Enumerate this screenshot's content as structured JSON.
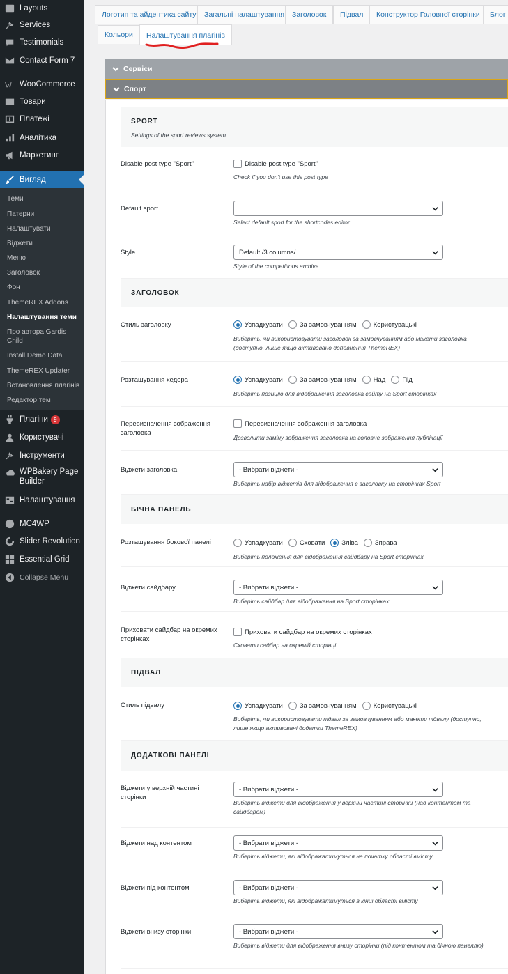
{
  "sidebar": {
    "menu": [
      {
        "label": "Layouts",
        "icon": "layouts-icon"
      },
      {
        "label": "Services",
        "icon": "wrench-icon"
      },
      {
        "label": "Testimonials",
        "icon": "comment-icon"
      },
      {
        "label": "Contact Form 7",
        "icon": "mail-icon"
      },
      {
        "label": "WooCommerce",
        "icon": "woocommerce-icon"
      },
      {
        "label": "Товари",
        "icon": "archive-icon"
      },
      {
        "label": "Платежі",
        "icon": "dollar-icon"
      },
      {
        "label": "Аналітика",
        "icon": "chart-bar-icon"
      },
      {
        "label": "Маркетинг",
        "icon": "megaphone-icon"
      },
      {
        "label": "Вигляд",
        "icon": "paintbrush-icon"
      }
    ],
    "submenu": [
      "Теми",
      "Патерни",
      "Налаштувати",
      "Віджети",
      "Меню",
      "Заголовок",
      "Фон",
      "ThemeREX Addons",
      "Налаштування теми",
      "Про автора Gardis Child",
      "Install Demo Data",
      "ThemeREX Updater",
      "Встановлення плагінів",
      "Редактор тем"
    ],
    "menu2": [
      {
        "label": "Плагіни",
        "icon": "plugins-icon",
        "badge": "9"
      },
      {
        "label": "Користувачі",
        "icon": "users-icon"
      },
      {
        "label": "Інструменти",
        "icon": "tools-icon"
      },
      {
        "label": "WPBakery Page Builder",
        "icon": "wpbakery-icon"
      },
      {
        "label": "Налаштування",
        "icon": "settings-icon"
      },
      {
        "label": "MC4WP",
        "icon": "mc4wp-icon"
      },
      {
        "label": "Slider Revolution",
        "icon": "slider-revolution-icon"
      },
      {
        "label": "Essential Grid",
        "icon": "grid-icon"
      },
      {
        "label": "Collapse Menu",
        "icon": "collapse-icon"
      }
    ]
  },
  "tabs": {
    "row1": [
      "Логотип та айдентика сайту",
      "Загальні налаштування",
      "Заголовок",
      "Підвал",
      "Конструктор Головної сторінки",
      "Блог"
    ],
    "row2": [
      "Кольори",
      "Налаштування плагінів"
    ]
  },
  "panels": {
    "services": "Сервіси",
    "sport": "Спорт"
  },
  "sections": {
    "sport": {
      "title": "SPORT",
      "subtitle": "Settings of the sport reviews system"
    },
    "header": {
      "title": "ЗАГОЛОВОК"
    },
    "sidebar": {
      "title": "БІЧНА ПАНЕЛЬ"
    },
    "footer": {
      "title": "ПІДВАЛ"
    },
    "extra": {
      "title": "ДОДАТКОВІ ПАНЕЛІ"
    }
  },
  "rows": {
    "disable_post": {
      "label": "Disable post type \"Sport\"",
      "checkbox": "Disable post type \"Sport\"",
      "desc": "Check if you don't use this post type"
    },
    "default_sport": {
      "label": "Default sport",
      "value": "",
      "desc": "Select default sport for the shortcodes editor"
    },
    "style": {
      "label": "Style",
      "value": "Default /3 columns/",
      "desc": "Style of the competitions archive"
    },
    "header_style": {
      "label": "Стиль заголовку",
      "options": [
        "Успадкувати",
        "За замовчуванням",
        "Користувацькі"
      ],
      "selected": "Успадкувати",
      "desc": "Виберіть, чи використовувати заголовок за замовчуванням або макети заголовка (доступно, лише якщо активовано доповнення ThemeREX)"
    },
    "header_pos": {
      "label": "Розташування хедера",
      "options": [
        "Успадкувати",
        "За замовчуванням",
        "Над",
        "Під"
      ],
      "selected": "Успадкувати",
      "desc": "Виберіть позицію для відображення заголовка сайту на Sport сторінках"
    },
    "header_image": {
      "label": "Перевизначення зображення заголовка",
      "checkbox": "Перевизначення зображення заголовка",
      "desc": "Дозволити заміну зображення заголовка на головне зображення публікації"
    },
    "header_widgets": {
      "label": "Віджети заголовка",
      "value": "- Вибрати віджети -",
      "desc": "Виберіть набір віджетів для відображення в заголовку на сторінках Sport"
    },
    "sidebar_pos": {
      "label": "Розташування бокової панелі",
      "options": [
        "Успадкувати",
        "Сховати",
        "Зліва",
        "Зправа"
      ],
      "selected": "Зліва",
      "desc": "Виберіть положення для відображення сайдбару на Sport сторінках"
    },
    "sidebar_widgets": {
      "label": "Віджети сайдбару",
      "value": "- Вибрати віджети -",
      "desc": "Виберіть сайдбар для відображення на Sport сторінках"
    },
    "hide_sidebar": {
      "label": "Приховати сайдбар на окремих сторінках",
      "checkbox": "Приховати сайдбар на окремих сторінках",
      "desc": "Сховати садбар на окремій сторінці"
    },
    "footer_style": {
      "label": "Стиль підвалу",
      "options": [
        "Успадкувати",
        "За замовчуванням",
        "Користувацькі"
      ],
      "selected": "Успадкувати",
      "desc": "Виберіть, чи використовувати підвал за замовчуванням або макети підвалу (доступно, лише якщо активовані додатки ThemeREX)"
    },
    "top_widgets": {
      "label": "Віджети у верхній частині сторінки",
      "value": "- Вибрати віджети -",
      "desc": "Виберіть віджети для відображення у верхній частині сторінки (над контентом та сайдбаром)"
    },
    "above_widgets": {
      "label": "Віджети над контентом",
      "value": "- Вибрати віджети -",
      "desc": "Виберіть віджети, які відображатимуться на початку області вмісту"
    },
    "below_widgets": {
      "label": "Віджети під контентом",
      "value": "- Вибрати віджети -",
      "desc": "Виберіть віджети, які відображатимуться в кінці області вмісту"
    },
    "bottom_widgets": {
      "label": "Віджети внизу сторінки",
      "value": "- Вибрати віджети -",
      "desc": "Виберіть віджети для відображення внизу сторінки (під контентом та бічною панеллю)"
    }
  }
}
